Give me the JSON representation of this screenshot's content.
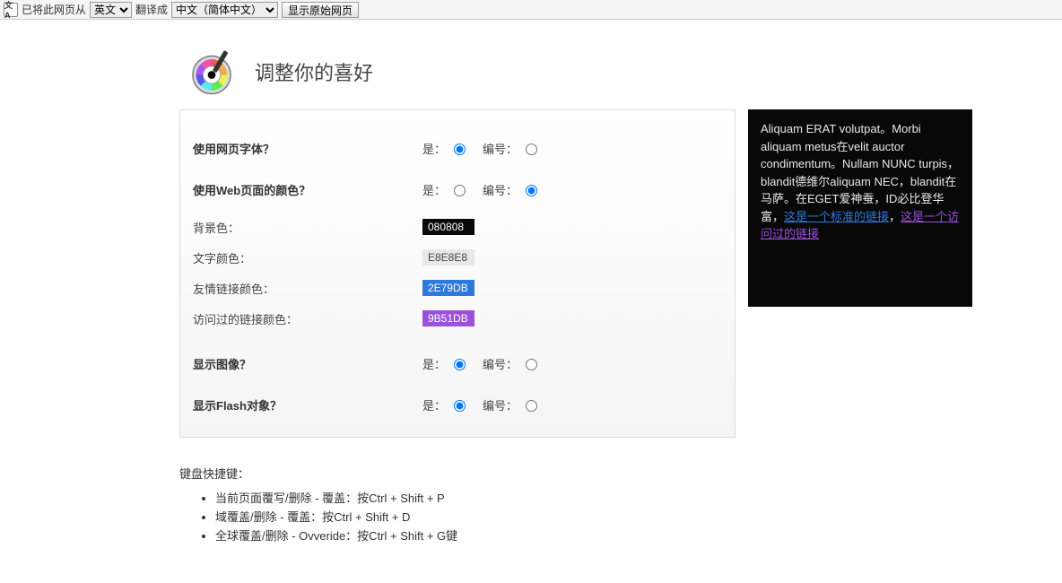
{
  "translateBar": {
    "iconText": "文A",
    "prefix": "已将此网页从",
    "langFrom": "英文",
    "middle": "翻译成",
    "langTo": "中文（简体中文）",
    "showOriginal": "显示原始网页"
  },
  "header": {
    "title": "调整你的喜好"
  },
  "options": {
    "yesLabel": "是：",
    "noLabel": "编号："
  },
  "rows": {
    "useWebFonts": "使用网页字体？",
    "useWebColors": "使用Web页面的颜色？",
    "bgColor": "背景色：",
    "textColor": "文字颜色：",
    "linkColor": "友情链接颜色：",
    "visitedColor": "访问过的链接颜色：",
    "showImages": "显示图像？",
    "showFlash": "显示Flash对象？"
  },
  "values": {
    "bgColor": "080808",
    "textColor": "E8E8E8",
    "linkColor": "2E79DB",
    "visitedColor": "9B51DB"
  },
  "preview": {
    "text1": "Aliquam ERAT volutpat。Morbi aliquam metus在velit auctor condimentum。Nullam NUNC turpis，blandit德维尔aliquam NEC，blandit在马萨。在EGET爱神蚕，ID必比登华富，",
    "linkNormal": "这是一个标准的链接",
    "sep": "，",
    "linkVisited": "这是一个访问过的链接"
  },
  "shortcuts": {
    "heading": "键盘快捷键：",
    "items": [
      "当前页面覆写/删除 - 覆盖：按Ctrl + Shift + P",
      "域覆盖/删除 - 覆盖：按Ctrl + Shift + D",
      "全球覆盖/删除 - Ovveride：按Ctrl + Shift + G键"
    ]
  }
}
